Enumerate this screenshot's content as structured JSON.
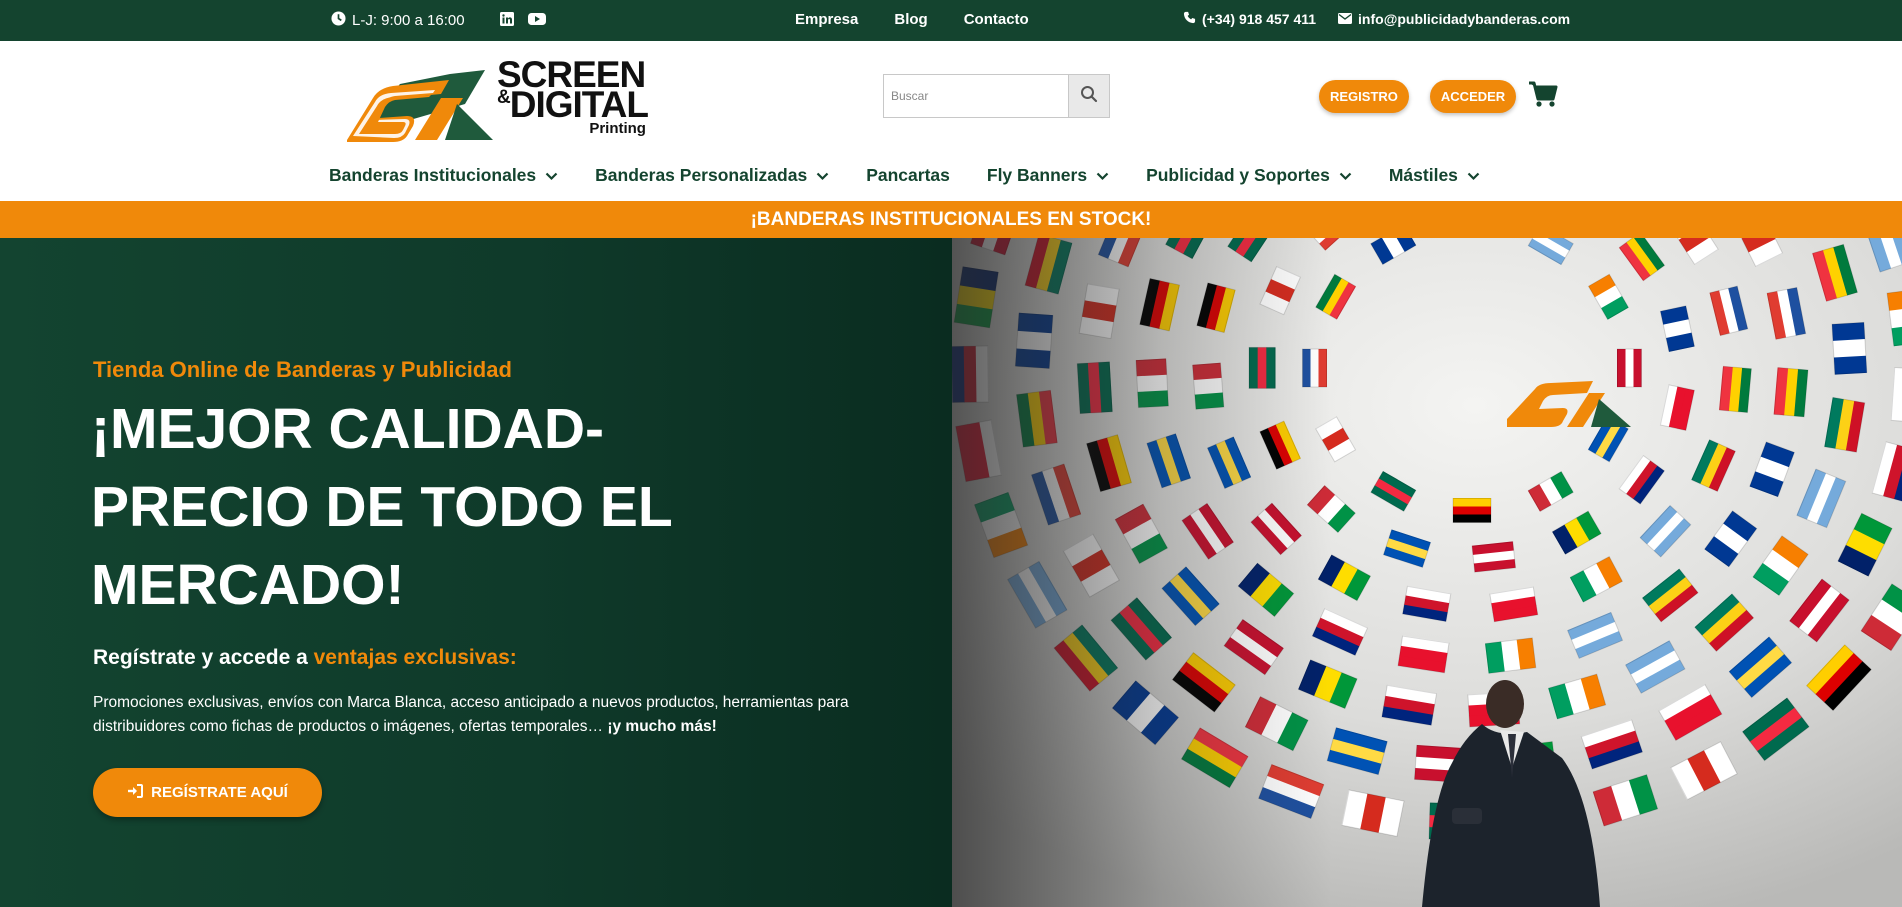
{
  "topbar": {
    "hours": "L-J: 9:00 a 16:00",
    "social": [
      {
        "icon": "linkedin-icon"
      },
      {
        "icon": "youtube-icon"
      }
    ],
    "links": [
      "Empresa",
      "Blog",
      "Contacto"
    ],
    "phone": "(+34) 918 457 411",
    "email": "info@publicidadybanderas.com"
  },
  "header": {
    "logo": {
      "line1": "SCREEN",
      "amp": "&",
      "line2": "DIGITAL",
      "line3": "Printing"
    },
    "search_placeholder": "Buscar",
    "register_label": "REGISTRO",
    "login_label": "ACCEDER"
  },
  "nav": [
    {
      "label": "Banderas Institucionales",
      "has_dropdown": true
    },
    {
      "label": "Banderas Personalizadas",
      "has_dropdown": true
    },
    {
      "label": "Pancartas",
      "has_dropdown": false
    },
    {
      "label": "Fly Banners",
      "has_dropdown": true
    },
    {
      "label": "Publicidad y Soportes",
      "has_dropdown": true
    },
    {
      "label": "Mástiles",
      "has_dropdown": true
    }
  ],
  "announcement": "¡BANDERAS INSTITUCIONALES EN STOCK!",
  "hero": {
    "kicker": "Tienda Online de Banderas y Publicidad",
    "headline": "¡MEJOR CALIDAD-PRECIO DE TODO EL MERCADO!",
    "subhead_prefix": "Regístrate y accede a ",
    "subhead_highlight": "ventajas exclusivas:",
    "paragraph": "Promociones exclusivas, envíos con Marca Blanca, acceso anticipado a nuevos productos, herramientas para distribuidores como fichas de productos o imágenes, ofertas temporales… ",
    "paragraph_bold": "¡y mucho más!",
    "cta_label": "REGÍSTRATE AQUÍ"
  },
  "colors": {
    "brand_green": "#14442f",
    "brand_orange": "#f0890a"
  }
}
